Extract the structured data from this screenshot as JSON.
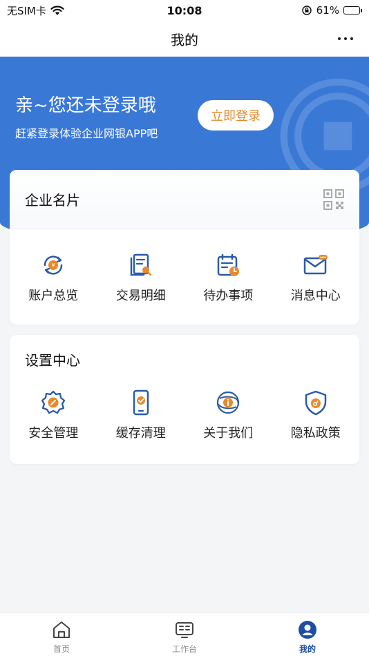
{
  "status_bar": {
    "carrier": "无SIM卡",
    "time": "10:08",
    "battery_percent": "61%",
    "battery_level": 0.61,
    "icons": [
      "wifi-icon",
      "orientation-lock-icon",
      "battery-charging-icon"
    ]
  },
  "nav": {
    "title": "我的",
    "more_icon": "more-dots-icon"
  },
  "hero": {
    "title": "亲~您还未登录哦",
    "subtitle": "赶紧登录体验企业网银APP吧",
    "login_label": "立即登录",
    "background_color": "#3a78d6",
    "button_text_color": "#e08a2a"
  },
  "business_card": {
    "title": "企业名片",
    "qr_icon": "qr-code-icon",
    "items": [
      {
        "label": "账户总览",
        "icon": "account-overview-icon"
      },
      {
        "label": "交易明细",
        "icon": "transaction-detail-icon"
      },
      {
        "label": "待办事项",
        "icon": "todo-calendar-icon"
      },
      {
        "label": "消息中心",
        "icon": "message-mail-icon"
      }
    ]
  },
  "settings": {
    "title": "设置中心",
    "items": [
      {
        "label": "安全管理",
        "icon": "security-gear-icon"
      },
      {
        "label": "缓存清理",
        "icon": "cache-phone-icon"
      },
      {
        "label": "关于我们",
        "icon": "about-info-icon"
      },
      {
        "label": "隐私政策",
        "icon": "privacy-shield-icon"
      }
    ]
  },
  "tab_bar": {
    "tabs": [
      {
        "label": "首页",
        "icon": "home-icon",
        "active": false
      },
      {
        "label": "工作台",
        "icon": "workbench-icon",
        "active": false
      },
      {
        "label": "我的",
        "icon": "profile-icon",
        "active": true
      }
    ],
    "active_color": "#1e4fa3"
  },
  "colors": {
    "icon_blue": "#2a5aa8",
    "icon_orange": "#e8892b"
  }
}
